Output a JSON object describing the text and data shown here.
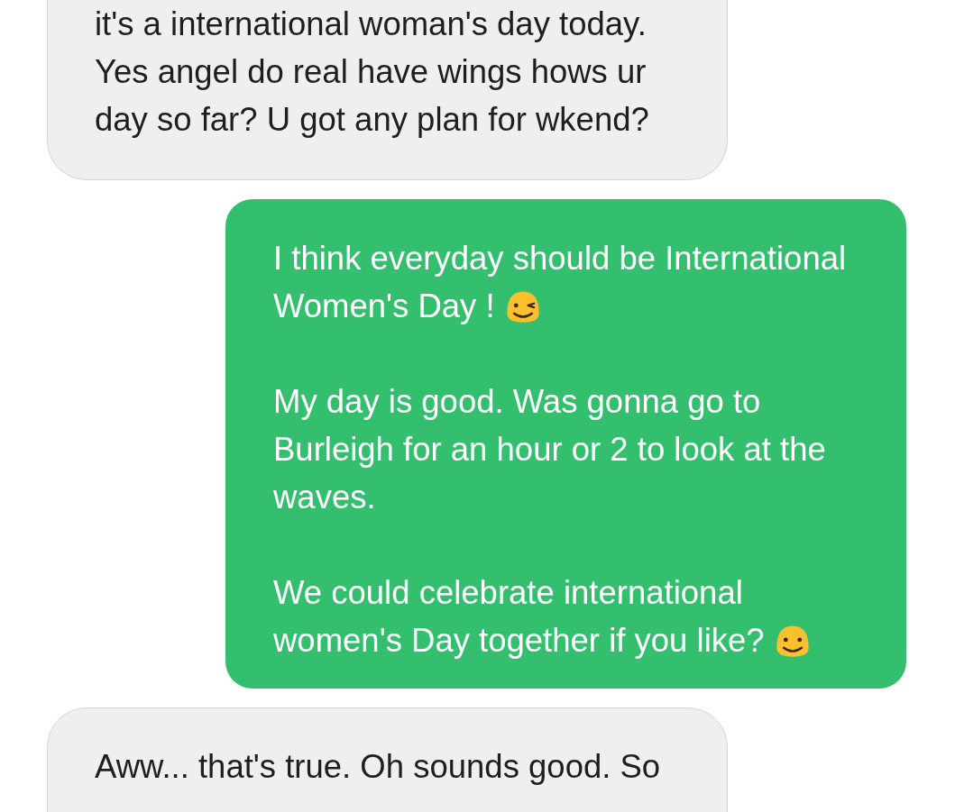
{
  "messages": [
    {
      "kind": "received",
      "paragraphs": [
        {
          "lines": [
            "it's a international woman's day today.",
            "Yes angel do real have wings hows ur",
            "day so far? U got any plan for wkend?"
          ]
        }
      ]
    },
    {
      "kind": "sent",
      "paragraphs": [
        {
          "lines": [
            "I think everyday should be International",
            "Women's Day !"
          ],
          "kind": "wink"
        },
        {
          "lines": [
            "My day is good. Was gonna go to",
            "Burleigh for an hour or 2 to look at the",
            "waves."
          ]
        },
        {
          "lines": [
            "We could celebrate international",
            "women's Day together if you like?"
          ],
          "kind": "smile"
        }
      ]
    },
    {
      "kind": "received",
      "paragraphs": [
        {
          "lines": [
            "Aww... that's true. Oh sounds good.  So"
          ]
        }
      ]
    }
  ]
}
